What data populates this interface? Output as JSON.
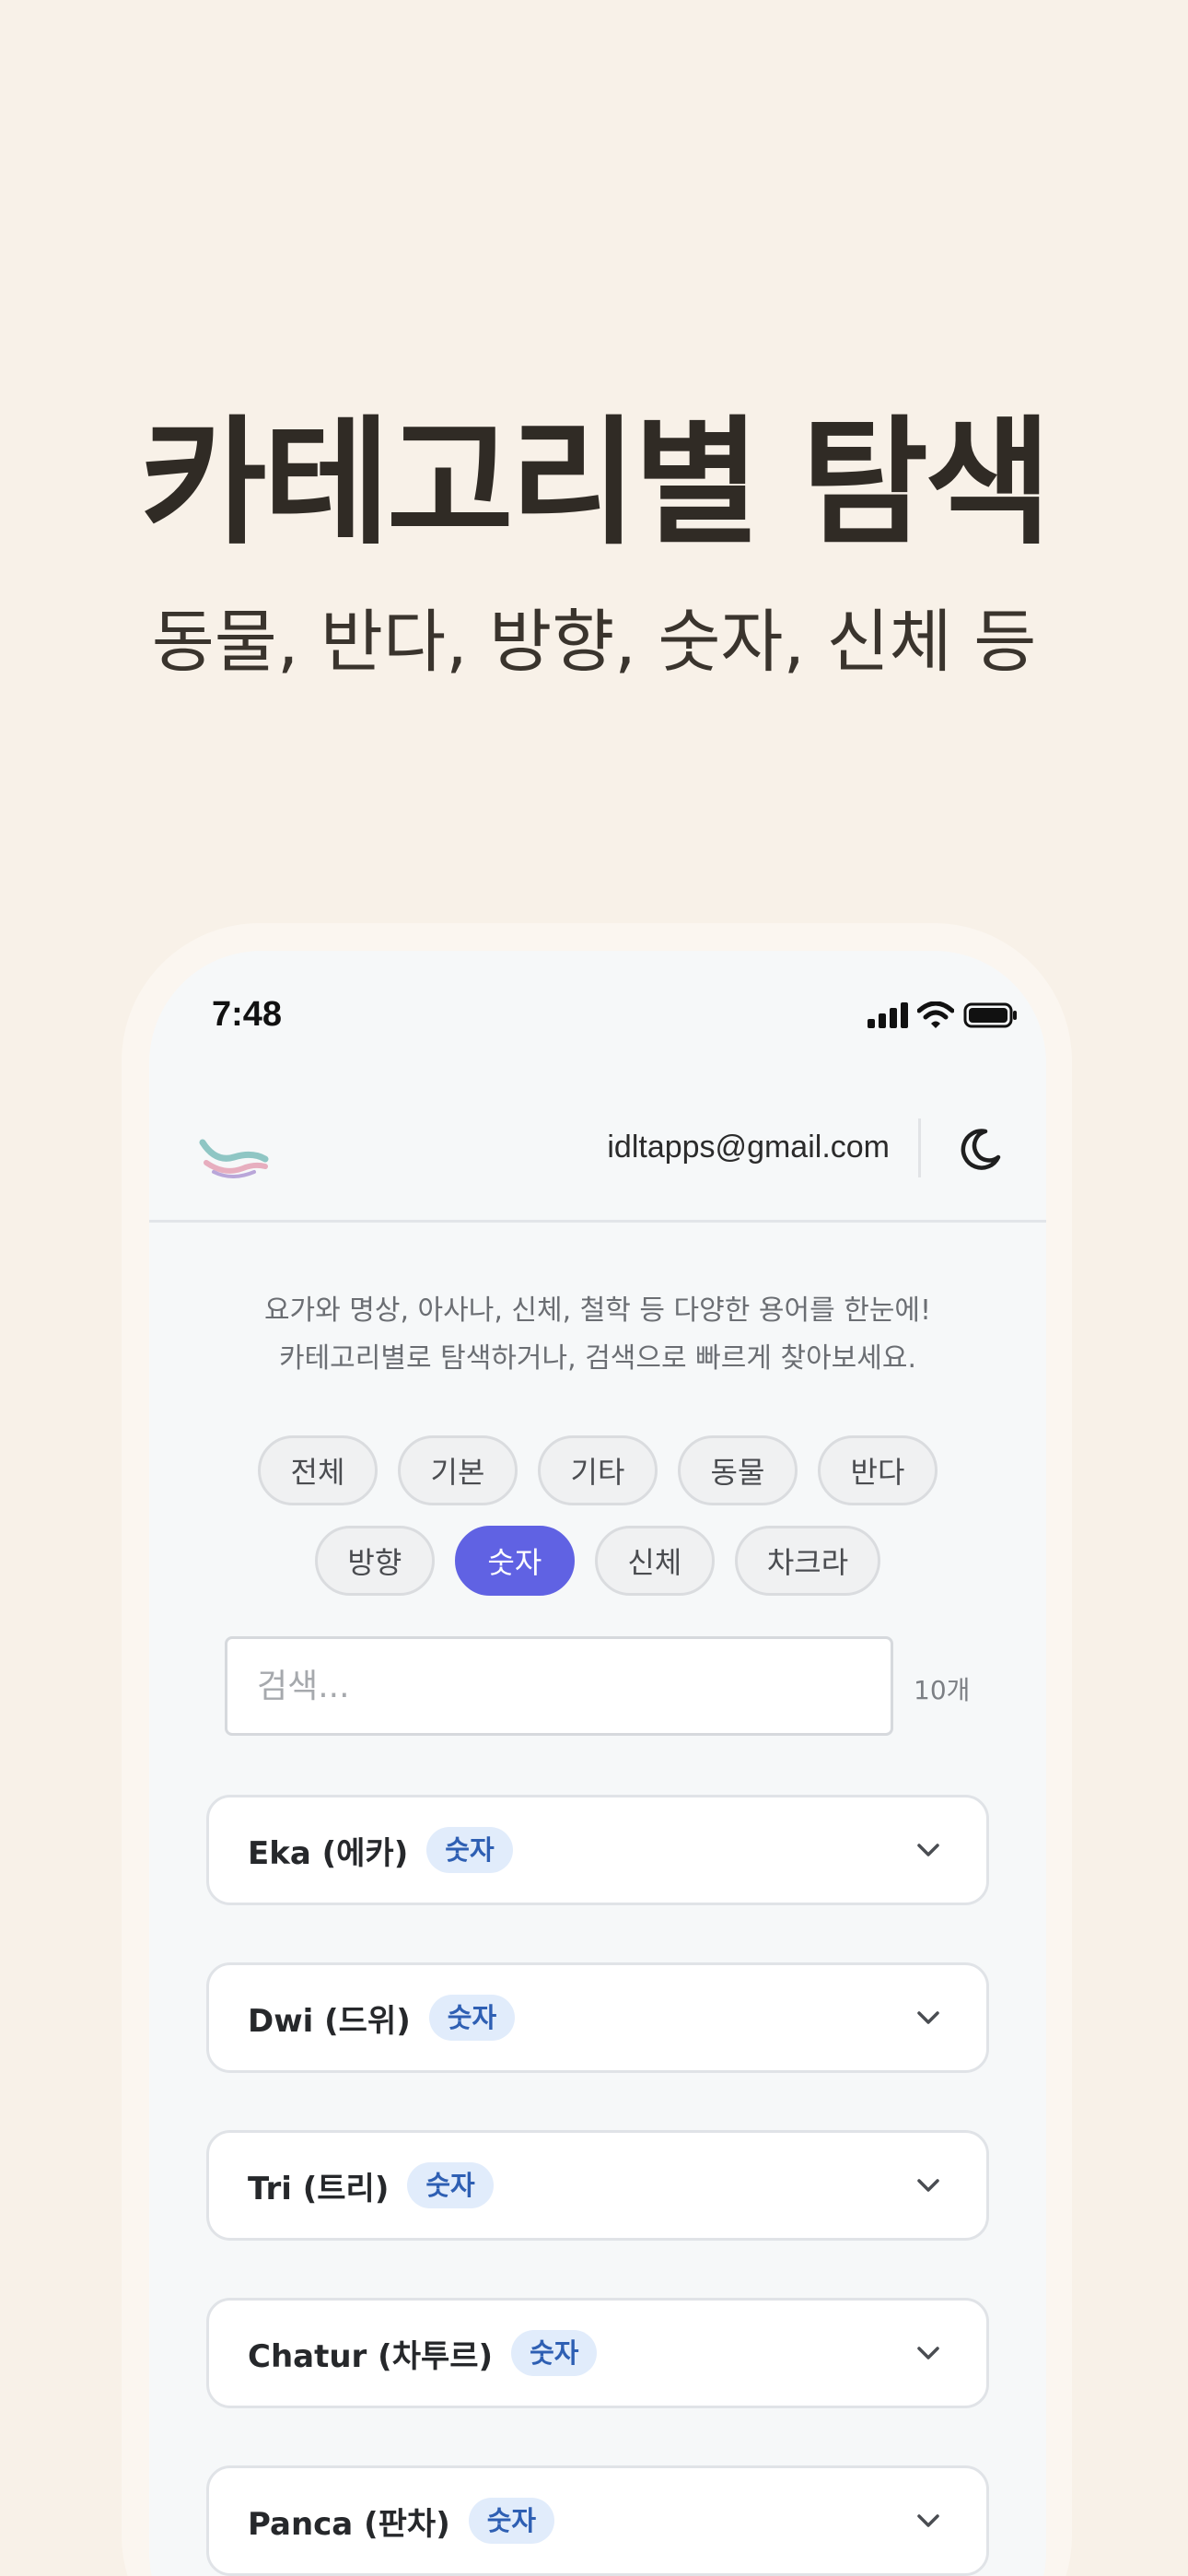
{
  "hero": {
    "title": "카테고리별 탐색",
    "subtitle": "동물, 반다, 방향, 숫자, 신체 등"
  },
  "status_bar": {
    "time": "7:48",
    "icons": [
      "signal-icon",
      "wifi-icon",
      "battery-icon"
    ]
  },
  "header": {
    "logo": "wave-logo",
    "email": "idltapps@gmail.com",
    "theme_icon": "moon-icon"
  },
  "intro": {
    "line1": "요가와 명상, 아사나, 신체, 철학 등 다양한 용어를 한눈에!",
    "line2": "카테고리별로 탐색하거나, 검색으로 빠르게 찾아보세요."
  },
  "categories": {
    "row1": [
      "전체",
      "기본",
      "기타",
      "동물",
      "반다"
    ],
    "row2": [
      "방향",
      "숫자",
      "신체",
      "차크라"
    ],
    "selected": "숫자"
  },
  "search": {
    "placeholder": "검색...",
    "value": "",
    "count": "10개"
  },
  "terms": [
    {
      "name": "Eka (에카)",
      "badge": "숫자"
    },
    {
      "name": "Dwi (드위)",
      "badge": "숫자"
    },
    {
      "name": "Tri (트리)",
      "badge": "숫자"
    },
    {
      "name": "Chatur (차투르)",
      "badge": "숫자"
    },
    {
      "name": "Panca (판차)",
      "badge": "숫자"
    }
  ],
  "colors": {
    "background": "#f8f1e8",
    "accent": "#6062e3",
    "badge_bg": "#e1ecfb",
    "badge_text": "#2e5fb3"
  }
}
